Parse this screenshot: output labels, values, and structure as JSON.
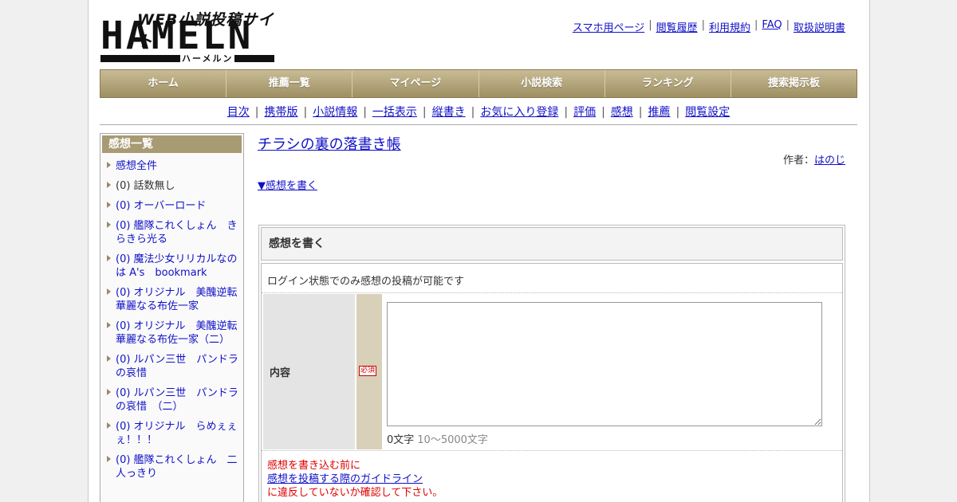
{
  "logo": {
    "tagline": "WEB小説投稿サイト",
    "name": "HAMELN",
    "kana": "ハーメルン"
  },
  "toplinks": [
    "スマホ用ページ",
    "閲覧履歴",
    "利用規約",
    "FAQ",
    "取扱説明書"
  ],
  "mainnav": [
    "ホーム",
    "推薦一覧",
    "マイページ",
    "小説検索",
    "ランキング",
    "捜索掲示板"
  ],
  "subnav": [
    "目次",
    "携帯版",
    "小説情報",
    "一括表示",
    "縦書き",
    "お気に入り登録",
    "評価",
    "感想",
    "推薦",
    "閲覧設定"
  ],
  "sidebar": {
    "title": "感想一覧",
    "items": [
      {
        "label": "感想全件",
        "link": true
      },
      {
        "label": "(0) 話数無し",
        "link": false
      },
      {
        "label": "(0) オーバーロード",
        "link": true
      },
      {
        "label": "(0) 艦隊これくしょん　きらきら光る",
        "link": true
      },
      {
        "label": "(0) 魔法少女リリカルなのは A's　bookmark",
        "link": true
      },
      {
        "label": "(0) オリジナル　美醜逆転　華麗なる布佐一家",
        "link": true
      },
      {
        "label": "(0) オリジナル　美醜逆転　華麗なる布佐一家（二）",
        "link": true
      },
      {
        "label": "(0) ルパン三世　パンドラの哀惜",
        "link": true
      },
      {
        "label": "(0) ルパン三世　パンドラの哀惜　（二）",
        "link": true
      },
      {
        "label": "(0) オリジナル　らめぇぇぇ！！！",
        "link": true
      },
      {
        "label": "(0) 艦隊これくしょん　二人っきり",
        "link": true
      }
    ]
  },
  "novel": {
    "title": "チラシの裏の落書き帳",
    "author_label": "作者：",
    "author": "はのじ"
  },
  "write_link": "▼感想を書く",
  "form": {
    "header": "感想を書く",
    "login_note": "ログイン状態でのみ感想の投稿が可能です",
    "content_label": "内容",
    "required": "必須",
    "count": "0文字",
    "range": "10～5000文字",
    "warn_before": "感想を書き込む前に",
    "guideline_link": "感想を投稿する際のガイドライン",
    "warn_after": "に違反していないか確認して下さい。"
  }
}
